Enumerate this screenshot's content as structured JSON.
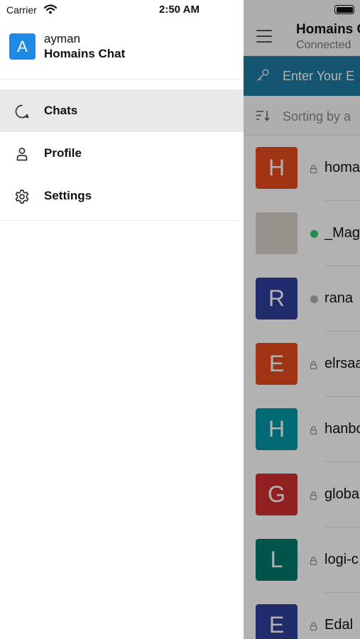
{
  "status_bar": {
    "carrier": "Carrier",
    "time": "2:50 AM"
  },
  "drawer": {
    "user": {
      "avatar_letter": "A",
      "avatar_color": "#1e88e5",
      "username": "ayman",
      "server_name": "Homains Chat"
    },
    "items": [
      {
        "label": "Chats",
        "icon": "chat-bubble-icon",
        "active": true
      },
      {
        "label": "Profile",
        "icon": "person-icon",
        "active": false
      },
      {
        "label": "Settings",
        "icon": "gear-icon",
        "active": false
      }
    ]
  },
  "main": {
    "header": {
      "title": "Homains C",
      "subtitle": "Connected"
    },
    "join_bar": {
      "text": "Enter Your E",
      "color": "#1d7aa3"
    },
    "sort_bar": {
      "text": "Sorting by a"
    },
    "rooms": [
      {
        "avatar_letter": "H",
        "color": "#e64a19",
        "indicator": "lock-icon",
        "name": "homa"
      },
      {
        "avatar_letter": "",
        "color": "#d8d2c8",
        "indicator": "online-dot",
        "name": "_Mag"
      },
      {
        "avatar_letter": "R",
        "color": "#303f9f",
        "indicator": "offline-dot",
        "name": "rana"
      },
      {
        "avatar_letter": "E",
        "color": "#e64a19",
        "indicator": "lock-icon",
        "name": "elrsaa"
      },
      {
        "avatar_letter": "H",
        "color": "#0097a7",
        "indicator": "lock-icon",
        "name": "hanbo"
      },
      {
        "avatar_letter": "G",
        "color": "#d32f2f",
        "indicator": "lock-icon",
        "name": "globa"
      },
      {
        "avatar_letter": "L",
        "color": "#00796b",
        "indicator": "lock-icon",
        "name": "logi-c"
      },
      {
        "avatar_letter": "E",
        "color": "#303f9f",
        "indicator": "lock-icon",
        "name": "Edal"
      }
    ],
    "online_color": "#2ecc71",
    "offline_color": "#b0b0b0",
    "overlay_color": "rgba(0,0,0,0.30)"
  }
}
